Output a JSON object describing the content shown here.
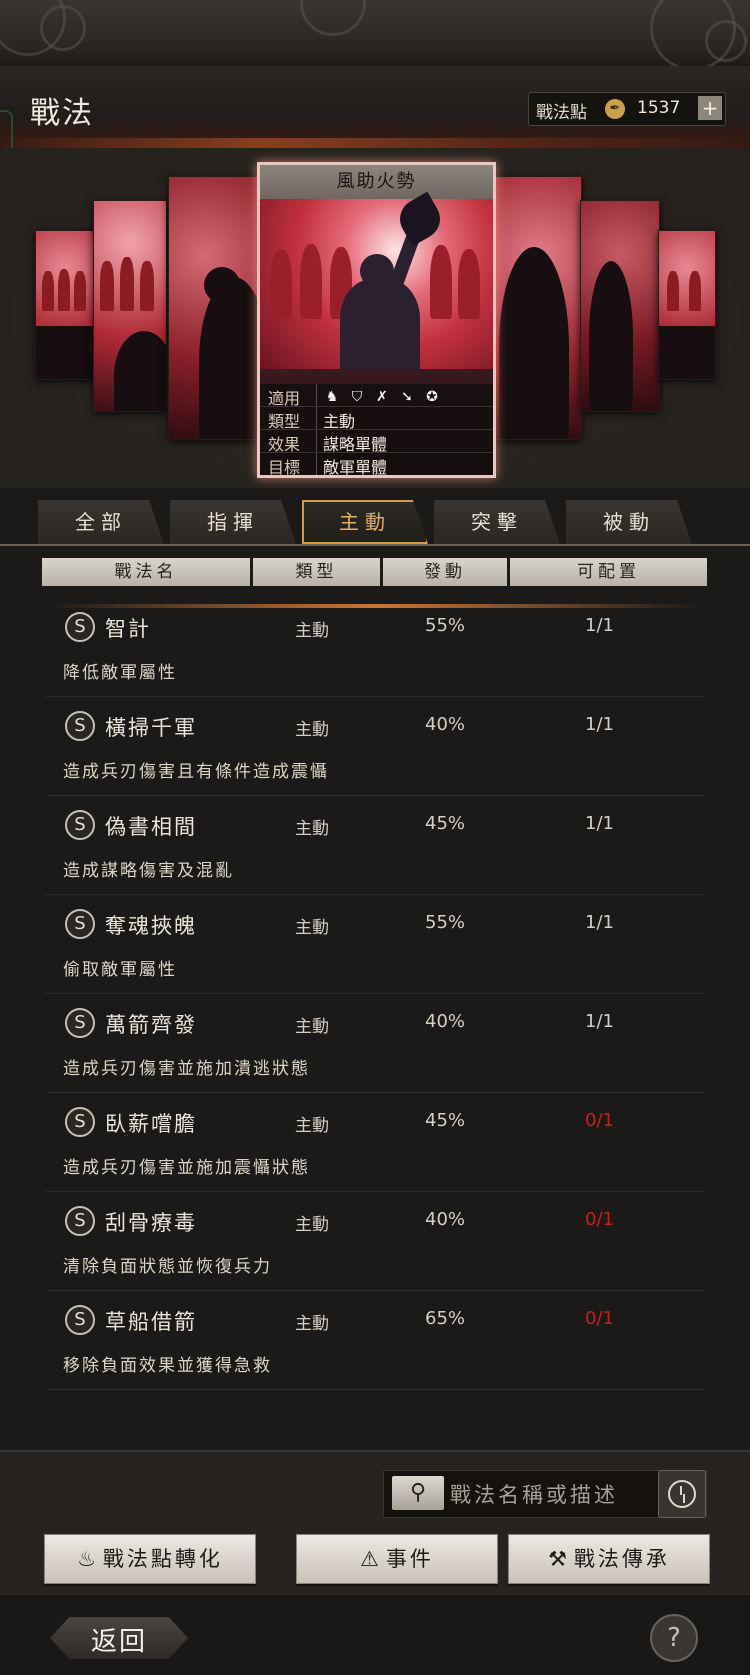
{
  "header": {
    "title": "戰法",
    "points_label": "戰法點",
    "points_value": "1537",
    "plus": "+"
  },
  "card": {
    "name": "風助火勢",
    "rows": [
      {
        "key": "適用",
        "value": ""
      },
      {
        "key": "類型",
        "value": "主動"
      },
      {
        "key": "效果",
        "value": "謀略單體"
      },
      {
        "key": "目標",
        "value": "敵軍單體"
      }
    ],
    "unit_icons": [
      "cavalry-icon",
      "shield-icon",
      "bow-icon",
      "spear-icon",
      "wheel-icon"
    ]
  },
  "tabs": [
    "全部",
    "指揮",
    "主動",
    "突擊",
    "被動"
  ],
  "active_tab": 2,
  "columns": [
    "戰法名",
    "類型",
    "發動",
    "可配置"
  ],
  "list": [
    {
      "badge": "S",
      "name": "智計",
      "type": "主動",
      "rate": "55%",
      "count": "1/1",
      "count_color": "#d6cec2",
      "desc": "降低敵軍屬性"
    },
    {
      "badge": "S",
      "name": "橫掃千軍",
      "type": "主動",
      "rate": "40%",
      "count": "1/1",
      "count_color": "#d6cec2",
      "desc": "造成兵刃傷害且有條件造成震懾"
    },
    {
      "badge": "S",
      "name": "偽書相間",
      "type": "主動",
      "rate": "45%",
      "count": "1/1",
      "count_color": "#d6cec2",
      "desc": "造成謀略傷害及混亂"
    },
    {
      "badge": "S",
      "name": "奪魂挾魄",
      "type": "主動",
      "rate": "55%",
      "count": "1/1",
      "count_color": "#d6cec2",
      "desc": "偷取敵軍屬性"
    },
    {
      "badge": "S",
      "name": "萬箭齊發",
      "type": "主動",
      "rate": "40%",
      "count": "1/1",
      "count_color": "#d6cec2",
      "desc": "造成兵刃傷害並施加潰逃狀態"
    },
    {
      "badge": "S",
      "name": "臥薪嚐膽",
      "type": "主動",
      "rate": "45%",
      "count": "0/1",
      "count_color": "#c81e1e",
      "desc": "造成兵刃傷害並施加震懾狀態"
    },
    {
      "badge": "S",
      "name": "刮骨療毒",
      "type": "主動",
      "rate": "40%",
      "count": "0/1",
      "count_color": "#c81e1e",
      "desc": "清除負面狀態並恢復兵力"
    },
    {
      "badge": "S",
      "name": "草船借箭",
      "type": "主動",
      "rate": "65%",
      "count": "0/1",
      "count_color": "#c81e1e",
      "desc": "移除負面效果並獲得急救"
    }
  ],
  "search": {
    "placeholder": "戰法名稱或描述"
  },
  "buttons": {
    "convert": "戰法點轉化",
    "event": "事件",
    "inherit": "戰法傳承"
  },
  "footer": {
    "back": "返回",
    "help": "?"
  },
  "colors": {
    "accent": "#d89a40",
    "danger": "#c81e1e"
  }
}
